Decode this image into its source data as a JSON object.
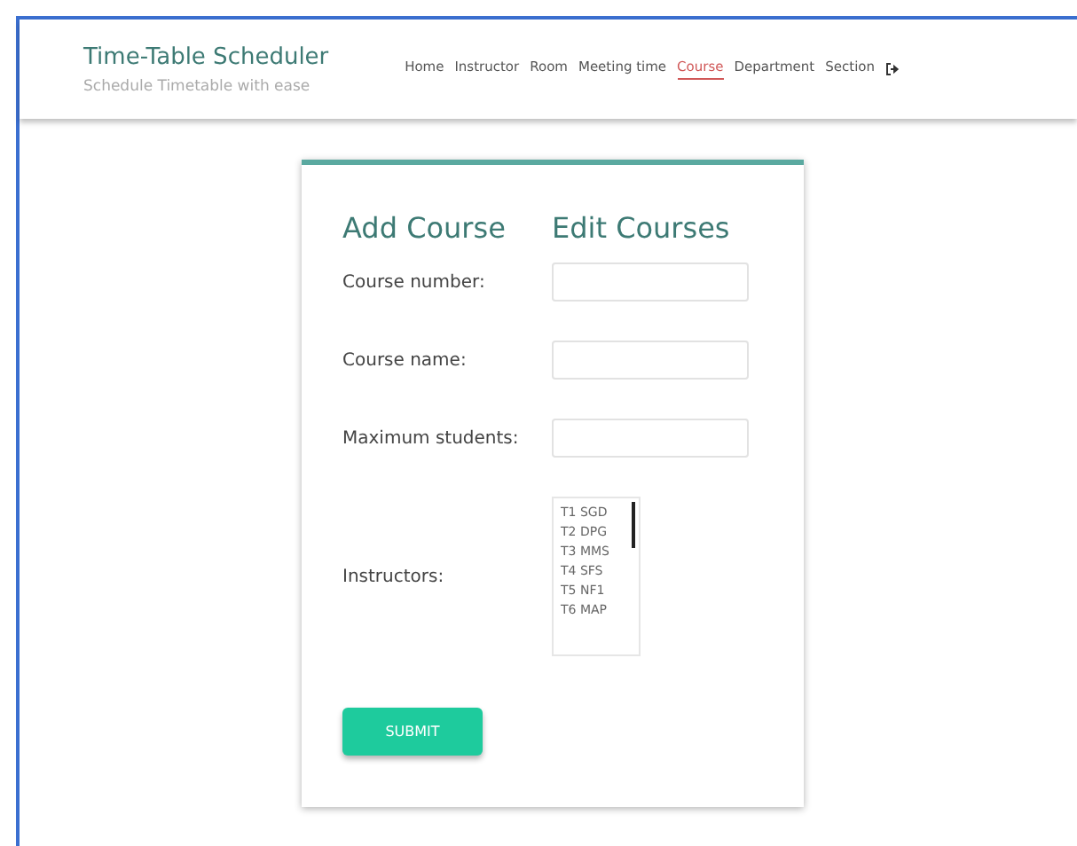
{
  "brand": {
    "title": "Time-Table Scheduler",
    "tagline": "Schedule Timetable with ease"
  },
  "nav": [
    {
      "label": "Home",
      "selected": false
    },
    {
      "label": "Instructor",
      "selected": false
    },
    {
      "label": "Room",
      "selected": false
    },
    {
      "label": "Meeting time",
      "selected": false
    },
    {
      "label": "Course",
      "selected": true
    },
    {
      "label": "Department",
      "selected": false
    },
    {
      "label": "Section",
      "selected": false
    }
  ],
  "form": {
    "headings": [
      "Add Course",
      "Edit Courses"
    ],
    "fields": [
      {
        "label": "Course number:",
        "kind": "text"
      },
      {
        "label": "Course name:",
        "kind": "text"
      },
      {
        "label": "Maximum students:",
        "kind": "text"
      },
      {
        "label": "Instructors:",
        "kind": "list",
        "options": [
          "T1 SGD",
          "T2 DPG",
          "T3 MMS",
          "T4 SFS",
          "T5 NF1",
          "T6 MAP"
        ]
      }
    ],
    "submit": "SUBMIT"
  }
}
